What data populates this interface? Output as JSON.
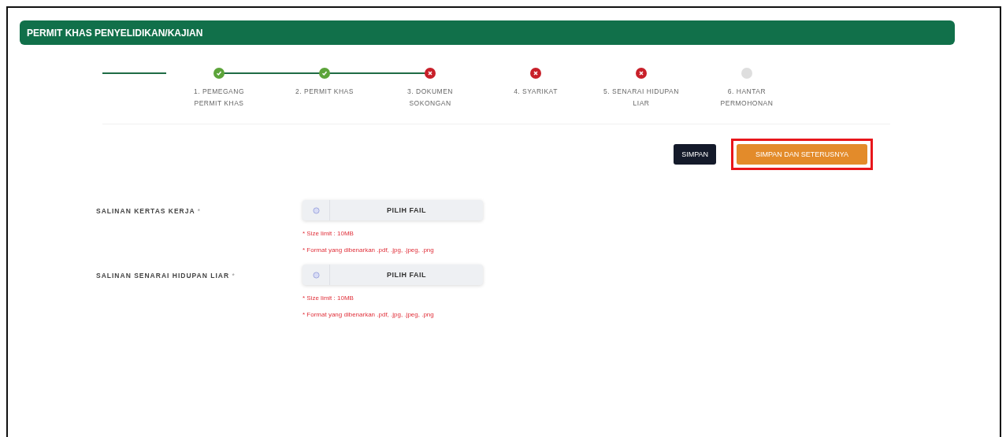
{
  "header": {
    "title": "PERMIT KHAS PENYELIDIKAN/KAJIAN"
  },
  "steps": [
    {
      "label": "1. PEMEGANG PERMIT KHAS",
      "kind": "done"
    },
    {
      "label": "2. PERMIT KHAS",
      "kind": "done"
    },
    {
      "label": "3. DOKUMEN SOKONGAN",
      "kind": "error"
    },
    {
      "label": "4. SYARIKAT",
      "kind": "error"
    },
    {
      "label": "5. SENARAI HIDUPAN LIAR",
      "kind": "error"
    },
    {
      "label": "6. HANTAR PERMOHONAN",
      "kind": "pending"
    }
  ],
  "buttons": [
    {
      "label": "SIMPAN",
      "kind": "dark",
      "highlighted": false
    },
    {
      "label": "SIMPAN DAN SETERUSNYA",
      "kind": "orange",
      "highlighted": true
    }
  ],
  "uploads": [
    {
      "label": "SALINAN KERTAS KERJA",
      "required_mark": "*",
      "button": "PILIH FAIL",
      "notes": [
        "* Size limit : 10MB",
        "* Format yang dibenarkan .pdf, .jpg, .jpeg, .png"
      ]
    },
    {
      "label": "SALINAN SENARAI HIDUPAN LIAR",
      "required_mark": "*",
      "button": "PILIH FAIL",
      "notes": [
        "* Size limit : 10MB",
        "* Format yang dibenarkan .pdf, .jpg, .jpeg, .png"
      ]
    }
  ]
}
